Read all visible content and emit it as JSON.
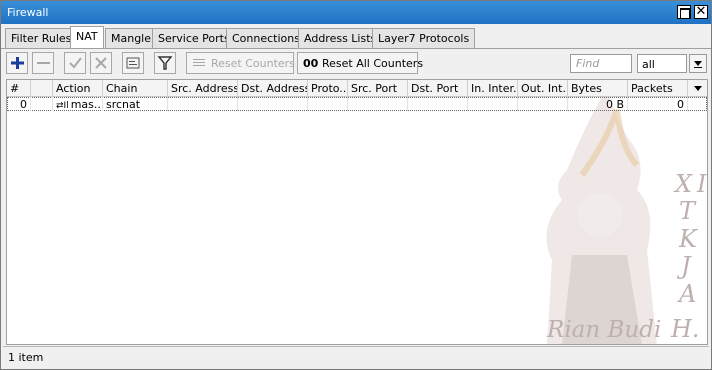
{
  "window": {
    "title": "Firewall"
  },
  "tabs": [
    {
      "label": "Filter Rules",
      "active": false
    },
    {
      "label": "NAT",
      "active": true
    },
    {
      "label": "Mangle",
      "active": false
    },
    {
      "label": "Service Ports",
      "active": false
    },
    {
      "label": "Connections",
      "active": false
    },
    {
      "label": "Address Lists",
      "active": false
    },
    {
      "label": "Layer7 Protocols",
      "active": false
    }
  ],
  "toolbar": {
    "reset_counters_label": "Reset Counters",
    "reset_all_counters_label": "Reset All Counters",
    "reset_all_counters_prefix": "00",
    "find_placeholder": "Find",
    "filter_select_value": "all"
  },
  "table": {
    "columns": [
      "#",
      "",
      "Action",
      "Chain",
      "Src. Address",
      "Dst. Address",
      "Proto...",
      "Src. Port",
      "Dst. Port",
      "In. Inter...",
      "Out. Int...",
      "Bytes",
      "Packets"
    ],
    "rows": [
      {
        "num": "0",
        "flag": "",
        "action_icon": "⇄Il",
        "action": "mas...",
        "chain": "srcnat",
        "src_address": "",
        "dst_address": "",
        "proto": "",
        "src_port": "",
        "dst_port": "",
        "in_interface": "",
        "out_interface": "",
        "bytes": "0 B",
        "packets": "0"
      }
    ]
  },
  "watermark": {
    "vertical_letters": [
      "X",
      "I",
      "T",
      "K",
      "J",
      "A",
      "H."
    ],
    "signature": "Rian Budi"
  },
  "status": {
    "item_count": "1 item"
  },
  "colors": {
    "titlebar": "#1f72c4",
    "add_icon": "#1a3d9c"
  }
}
